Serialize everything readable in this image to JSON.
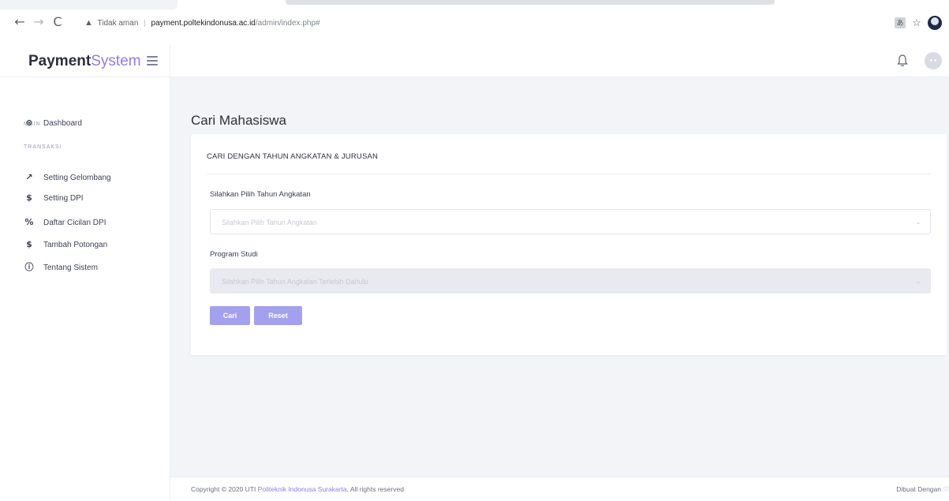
{
  "browser": {
    "back": "←",
    "forward": "→",
    "reload": "C",
    "security_label": "Tidak aman",
    "url_host": "payment.poltekindonusa.ac.id",
    "url_path": "/admin/index.php#"
  },
  "header": {
    "brand_bold": "Payment",
    "brand_light": "System"
  },
  "sidebar": {
    "sections": [
      {
        "heading": "MAIN",
        "items": [
          {
            "label": "Dashboard",
            "icon": "dashboard-icon"
          }
        ]
      },
      {
        "heading": "TRANSAKSI",
        "items": [
          {
            "label": "Setting Gelombang",
            "icon": "trending-icon"
          },
          {
            "label": "Setting DPI",
            "icon": "dollar-icon"
          },
          {
            "label": "Daftar Cicilan DPI",
            "icon": "percent-icon"
          },
          {
            "label": "Tambah Potongan",
            "icon": "dollar-icon"
          },
          {
            "label": "Tentang Sistem",
            "icon": "info-icon"
          }
        ]
      }
    ]
  },
  "main": {
    "page_title": "Cari Mahasiswa",
    "card_title": "CARI DENGAN TAHUN ANGKATAN & JURUSAN",
    "year_label": "Silahkan Pilih Tahun Angkatan",
    "year_placeholder": "Silahkan Pilih Tahun Angkatan",
    "study_label": "Program Studi",
    "study_placeholder": "Silahkan Pilih Tahun Angkatan Terlebih Dahulu",
    "search_button": "Cari",
    "reset_button": "Reset"
  },
  "footer": {
    "copyright_prefix": "Copyright © 2020 UTI",
    "org_link": "Politeknik Indonusa Surakarta",
    "copyright_suffix": ". All rights reserved",
    "made_with": "Dibuat Dengan"
  },
  "colors": {
    "accent": "#8f7de5",
    "button": "#a3a0ee",
    "background": "#f3f4f7"
  }
}
